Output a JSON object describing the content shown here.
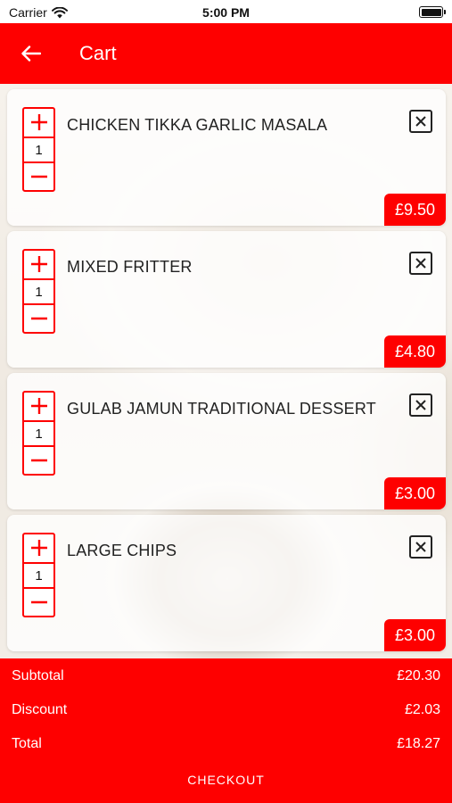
{
  "status_bar": {
    "carrier": "Carrier",
    "time": "5:00 PM"
  },
  "header": {
    "title": "Cart",
    "back_icon": "arrow-left-icon"
  },
  "cart": {
    "items": [
      {
        "name": "CHICKEN TIKKA GARLIC MASALA",
        "quantity": "1",
        "price": "£9.50"
      },
      {
        "name": "MIXED FRITTER",
        "quantity": "1",
        "price": "£4.80"
      },
      {
        "name": "GULAB JAMUN TRADITIONAL DESSERT",
        "quantity": "1",
        "price": "£3.00"
      },
      {
        "name": "LARGE CHIPS",
        "quantity": "1",
        "price": "£3.00"
      }
    ]
  },
  "summary": {
    "subtotal_label": "Subtotal",
    "subtotal_value": "£20.30",
    "discount_label": "Discount",
    "discount_value": "£2.03",
    "total_label": "Total",
    "total_value": "£18.27",
    "checkout_label": "CHECKOUT"
  },
  "colors": {
    "accent": "#fe0000",
    "text": "#222222",
    "surface": "#ffffff"
  }
}
